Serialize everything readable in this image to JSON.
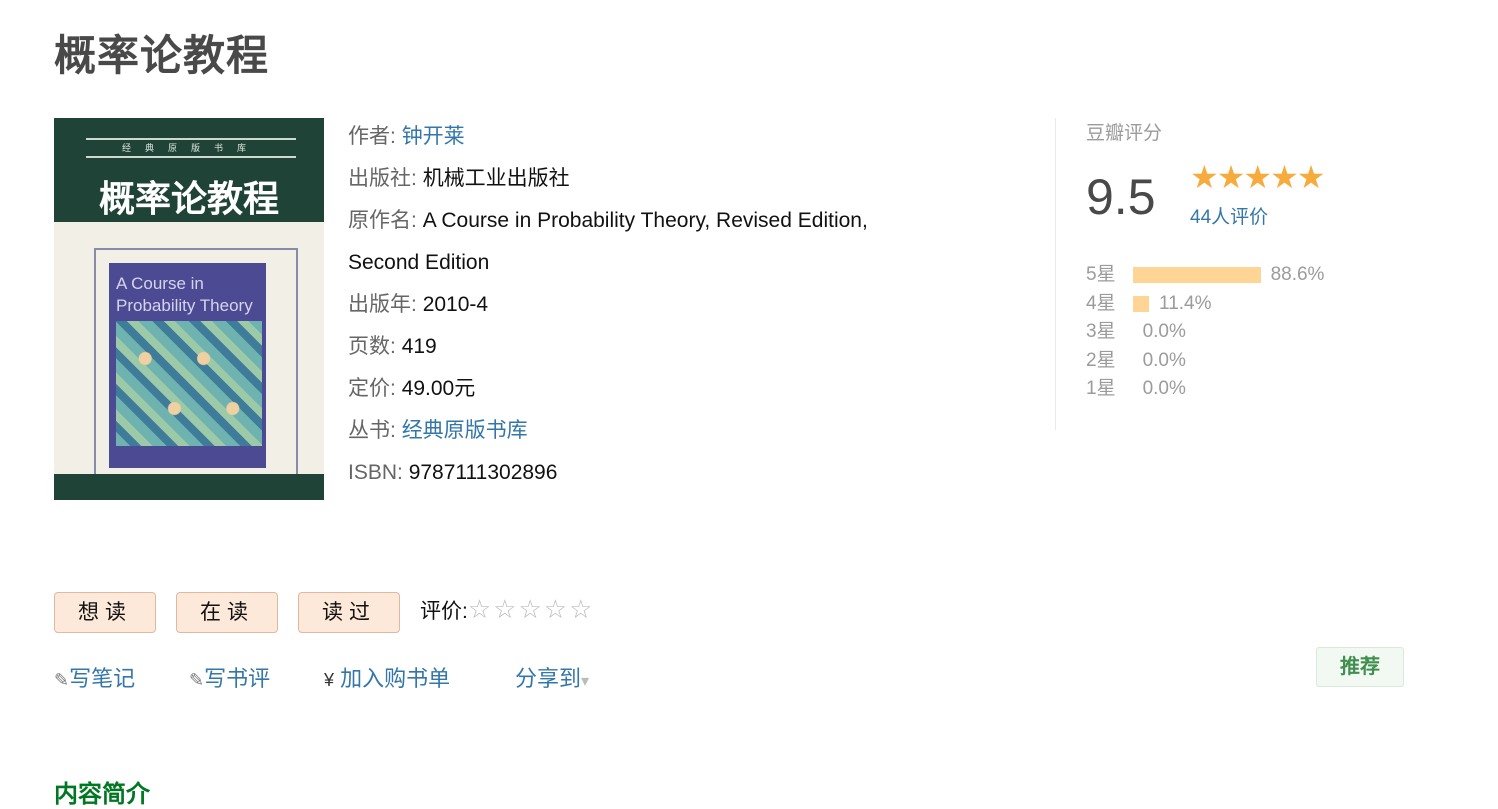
{
  "book": {
    "title": "概率论教程"
  },
  "cover": {
    "series": "经典原版书库",
    "title": "概率论教程",
    "en_title_1": "A Course in",
    "en_title_2": "Probability Theory"
  },
  "info": {
    "author_label": "作者:",
    "author": "钟开莱",
    "publisher_label": "出版社:",
    "publisher": "机械工业出版社",
    "orig_label": "原作名:",
    "orig_1": "A Course in Probability Theory, Revised Edition,",
    "orig_2": "Second Edition",
    "year_label": "出版年:",
    "year": "2010-4",
    "pages_label": "页数:",
    "pages": "419",
    "price_label": "定价:",
    "price": "49.00元",
    "series_label": "丛书:",
    "series": "经典原版书库",
    "isbn_label": "ISBN:",
    "isbn": "9787111302896"
  },
  "rating": {
    "label": "豆瓣评分",
    "score": "9.5",
    "stars": "★★★★★",
    "votes": "44人评价",
    "dist": [
      {
        "label": "5星",
        "pct": 88.6,
        "text": "88.6%"
      },
      {
        "label": "4星",
        "pct": 11.4,
        "text": "11.4%"
      },
      {
        "label": "3星",
        "pct": 0,
        "text": "0.0%"
      },
      {
        "label": "2星",
        "pct": 0,
        "text": "0.0%"
      },
      {
        "label": "1星",
        "pct": 0,
        "text": "0.0%"
      }
    ]
  },
  "actions": {
    "want": "想读",
    "reading": "在读",
    "read": "读过",
    "rate_label": "评价:",
    "rate_stars": "☆☆☆☆☆"
  },
  "links": {
    "note": "写笔记",
    "review": "写书评",
    "yen": "¥",
    "cart": "加入购书单",
    "share": "分享到",
    "share_arrow": "▾",
    "pencil": "✎"
  },
  "recommend": "推荐",
  "intro_heading": "内容简介"
}
